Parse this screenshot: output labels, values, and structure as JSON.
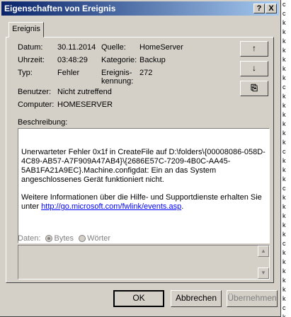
{
  "window": {
    "title": "Eigenschaften von Ereignis"
  },
  "titlebar": {
    "help_label": "?",
    "close_label": "X"
  },
  "tab": {
    "label": "Ereignis"
  },
  "fields": {
    "datum_label": "Datum:",
    "datum_value": "30.11.2014",
    "quelle_label": "Quelle:",
    "quelle_value": "HomeServer",
    "uhrzeit_label": "Uhrzeit:",
    "uhrzeit_value": "03:48:29",
    "kategorie_label": "Kategorie:",
    "kategorie_value": "Backup",
    "typ_label": "Typ:",
    "typ_value": "Fehler",
    "ereigniskennung_label_1": "Ereignis-",
    "ereigniskennung_label_2": "kennung:",
    "ereigniskennung_value": "272",
    "benutzer_label": "Benutzer:",
    "benutzer_value": "Nicht zutreffend",
    "computer_label": "Computer:",
    "computer_value": "HOMESERVER"
  },
  "nav": {
    "up_symbol": "↑",
    "down_symbol": "↓",
    "copy_symbol": "⎘"
  },
  "description": {
    "label": "Beschreibung:",
    "text": "Unerwarteter Fehler 0x1f in CreateFile auf D:\\folders\\{00008086-058D-4C89-AB57-A7F909A47AB4}\\{2686E57C-7209-4B0C-AA45-5AB1FA21A9EC}.Machine.configdat: Ein an das System angeschlossenes Gerät funktioniert nicht.",
    "more_info_prefix": "Weitere Informationen über die Hilfe- und Supportdienste erhalten Sie unter ",
    "link": "http://go.microsoft.com/fwlink/events.asp",
    "more_info_suffix": "."
  },
  "data_section": {
    "label": "Daten:",
    "bytes_label": "Bytes",
    "words_label": "Wörter",
    "selected": "Bytes"
  },
  "buttons": {
    "ok": "OK",
    "cancel": "Abbrechen",
    "apply": "Übernehmen"
  },
  "background_window_chars": [
    "c",
    "c",
    "k",
    "k",
    "k",
    "k",
    "k",
    "k",
    "k",
    "c",
    "k",
    "k",
    "k",
    "k",
    "k",
    "k",
    "c",
    "k",
    "k",
    "k",
    "c",
    "k",
    "k",
    "k",
    "k",
    "k",
    "c",
    "k",
    "k",
    "k",
    "k",
    "k",
    "k",
    "c",
    "k"
  ]
}
